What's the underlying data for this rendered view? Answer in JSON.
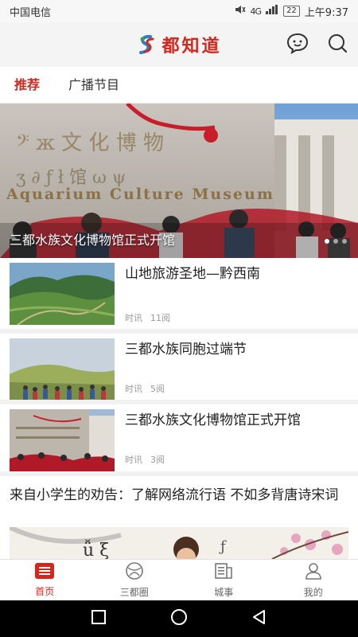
{
  "status_bar": {
    "carrier": "中国电信",
    "network": "4G",
    "battery": "22",
    "time": "上午9:37"
  },
  "header": {
    "app_name": "都知道",
    "brand_color": "#d3261d"
  },
  "tabs": [
    {
      "label": "推荐",
      "active": true
    },
    {
      "label": "广播节目",
      "active": false
    }
  ],
  "banner": {
    "caption": "三都水族文化博物馆正式开馆",
    "sign_text": "Aquarium Culture Museum",
    "slide_count": 3,
    "active_slide": 1
  },
  "news": [
    {
      "title": "山地旅游圣地—黔西南",
      "category": "时讯",
      "reads": "11阅"
    },
    {
      "title": "三都水族同胞过端节",
      "category": "时讯",
      "reads": "5阅"
    },
    {
      "title": "三都水族文化博物馆正式开馆",
      "category": "时讯",
      "reads": "3阅"
    }
  ],
  "article": {
    "title": "来自小学生的劝告：了解网络流行语 不如多背唐诗宋词"
  },
  "tabbar": [
    {
      "label": "首页",
      "icon": "home-list-icon",
      "active": true
    },
    {
      "label": "三都圈",
      "icon": "circle-compass-icon",
      "active": false
    },
    {
      "label": "城事",
      "icon": "city-news-icon",
      "active": false
    },
    {
      "label": "我的",
      "icon": "profile-icon",
      "active": false
    }
  ],
  "system_nav": {
    "icons": [
      "recent-apps-icon",
      "home-icon",
      "back-icon"
    ]
  }
}
